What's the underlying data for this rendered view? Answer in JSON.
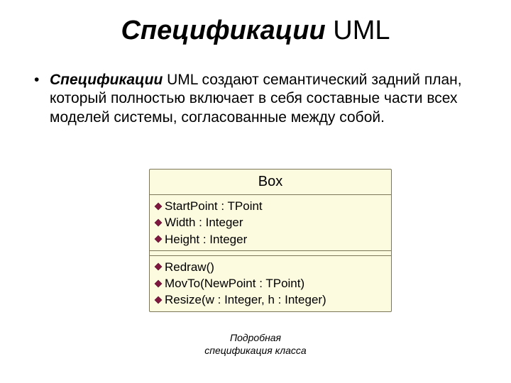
{
  "title": {
    "emph": "Спецификации",
    "rest": " UML"
  },
  "bullet": {
    "lead": "Спецификации",
    "rest": " UML создают семантический задний план, который полностью включает в себя составные части всех моделей системы, согласованные между собой."
  },
  "classbox": {
    "name": "Box",
    "attributes": [
      "StartPoint : TPoint",
      "Width : Integer",
      "Height : Integer"
    ],
    "operations": [
      "Redraw()",
      "MovTo(NewPoint : TPoint)",
      "Resize(w : Integer, h : Integer)"
    ]
  },
  "caption": {
    "line1": "Подробная",
    "line2": "спецификация класса"
  }
}
